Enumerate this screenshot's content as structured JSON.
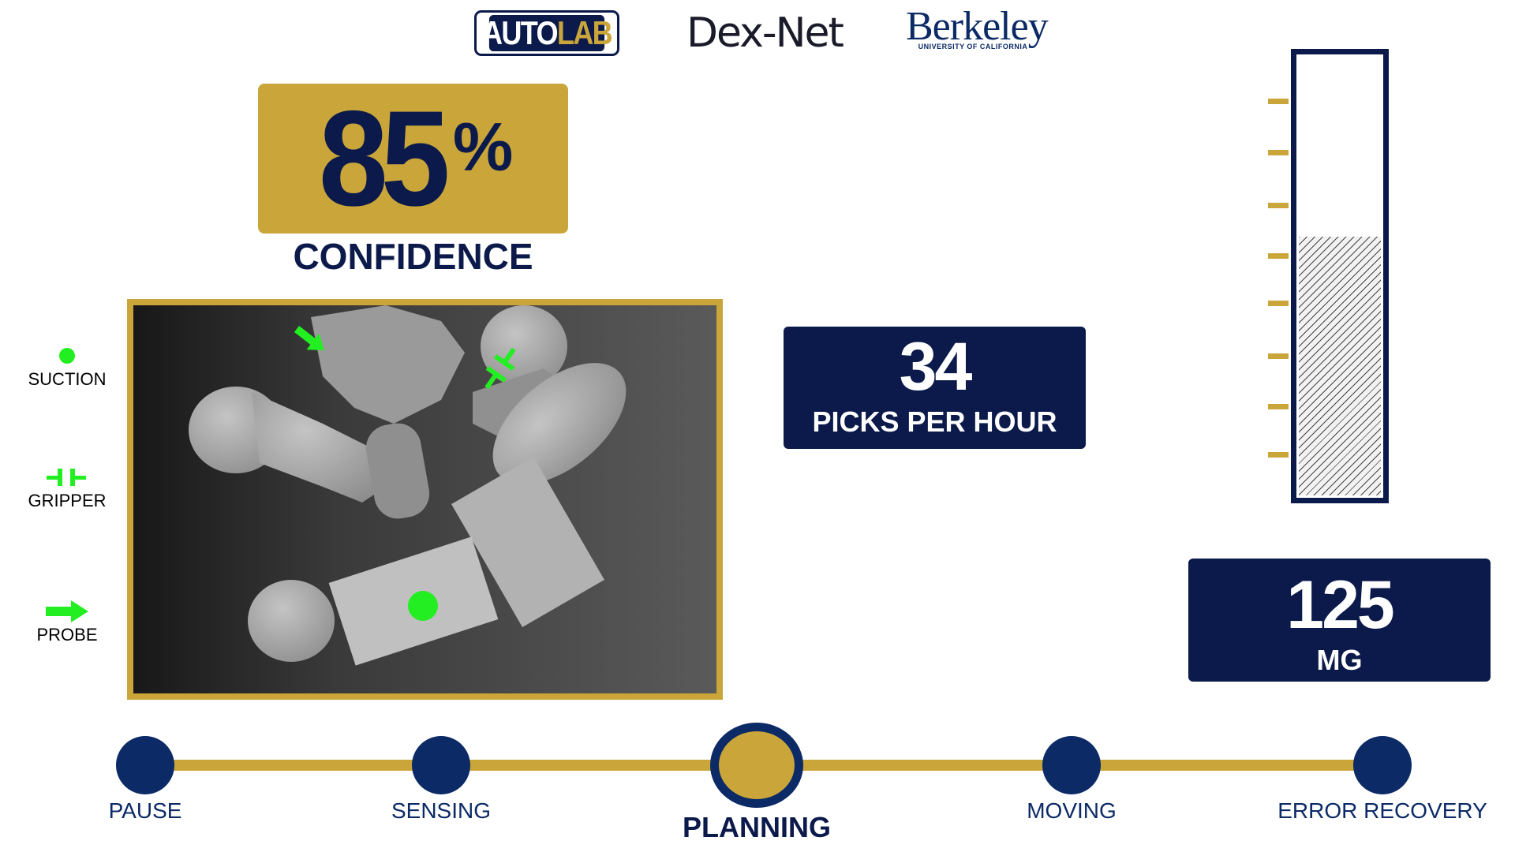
{
  "header": {
    "logo_autolab_a": "AUTO",
    "logo_autolab_b": "LAB",
    "logo_dexnet": "Dex-Net",
    "logo_berkeley": "Berkeley",
    "logo_berkeley_sub": "UNIVERSITY OF CALIFORNIA"
  },
  "confidence": {
    "value": "85",
    "unit": "%",
    "label": "CONFIDENCE"
  },
  "legend": [
    {
      "label": "SUCTION",
      "icon": "suction-dot-icon"
    },
    {
      "label": "GRIPPER",
      "icon": "gripper-icon"
    },
    {
      "label": "PROBE",
      "icon": "probe-arrow-icon"
    }
  ],
  "picks": {
    "value": "34",
    "label": "PICKS PER HOUR"
  },
  "gauge": {
    "fill_fraction": 0.59,
    "tick_count": 8
  },
  "weight": {
    "value": "125",
    "label": "MG"
  },
  "steps": [
    {
      "label": "PAUSE",
      "active": false
    },
    {
      "label": "SENSING",
      "active": false
    },
    {
      "label": "PLANNING",
      "active": true
    },
    {
      "label": "MOVING",
      "active": false
    },
    {
      "label": "ERROR RECOVERY",
      "active": false
    }
  ],
  "colors": {
    "navy": "#0b1a4a",
    "gold": "#c9a53a",
    "marker": "#22ee22"
  }
}
